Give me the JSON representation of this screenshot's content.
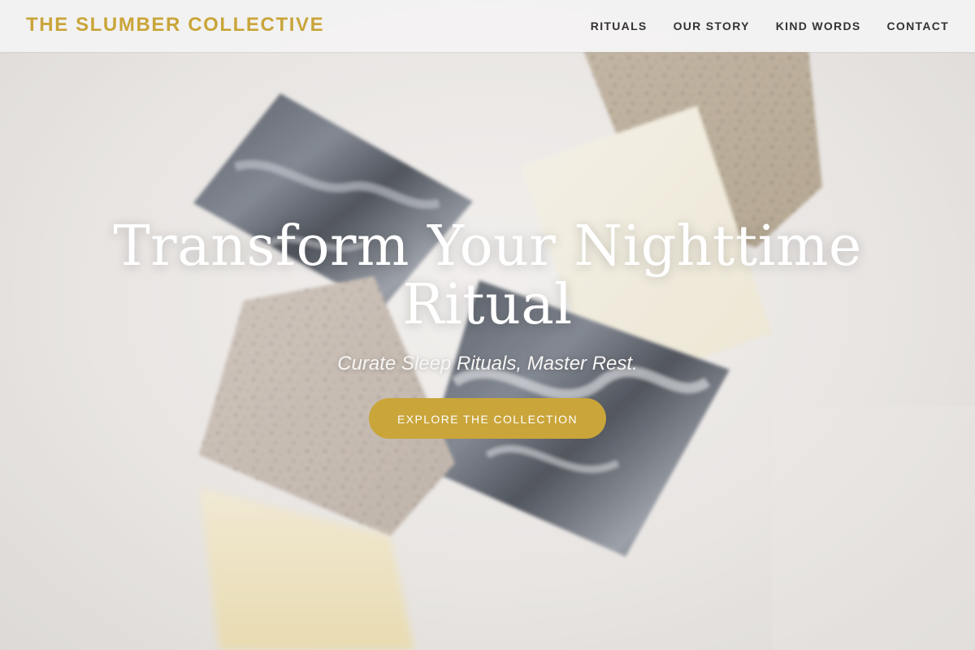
{
  "brand": {
    "name": "THE SLUMBER COLLECTIVE",
    "color": "#c9a53a"
  },
  "nav": {
    "items": [
      {
        "label": "RITUALS"
      },
      {
        "label": "OUR STORY"
      },
      {
        "label": "KIND WORDS"
      },
      {
        "label": "CONTACT"
      }
    ]
  },
  "hero": {
    "title": "Transform Your Nighttime Ritual",
    "tagline": "Curate Sleep Rituals, Master Rest.",
    "cta_label": "EXPLORE THE COLLECTION",
    "background": "handmade-soap-bars-photo"
  },
  "colors": {
    "accent": "#c9a53a",
    "header_bg": "#f4f3f2",
    "nav_text": "#333333",
    "hero_text": "#ffffff"
  }
}
